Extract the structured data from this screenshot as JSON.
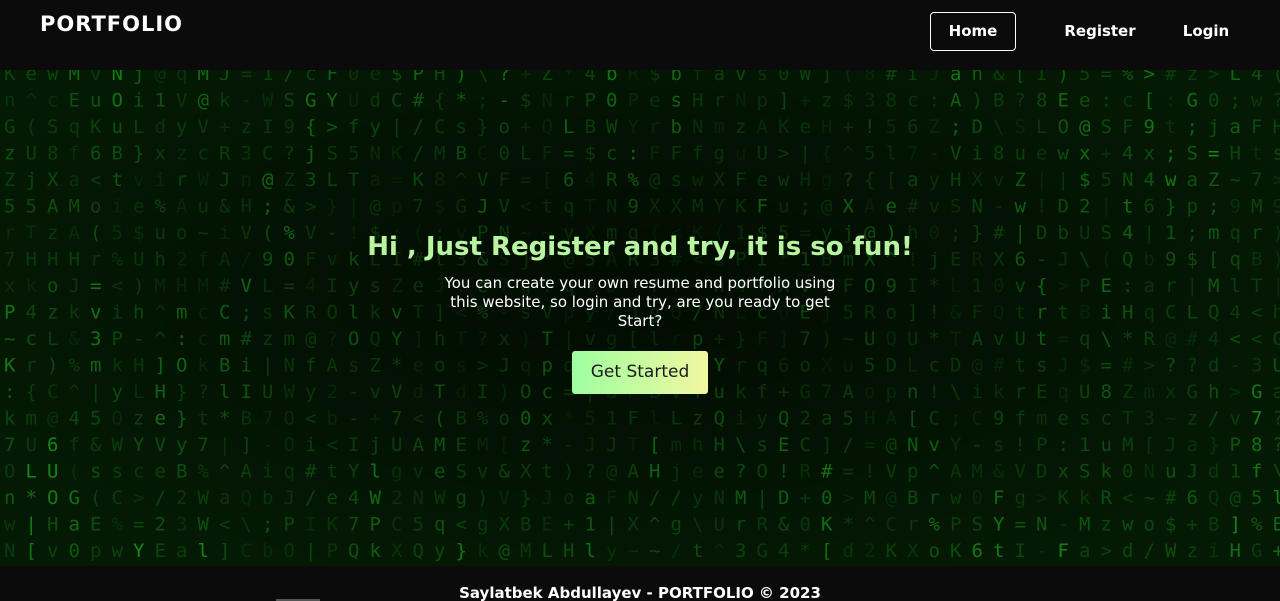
{
  "header": {
    "brand": "PORTFOLIO",
    "nav": [
      {
        "label": "Home",
        "active": true
      },
      {
        "label": "Register"
      },
      {
        "label": "Login"
      }
    ]
  },
  "hero": {
    "title": "Hi , Just Register and try, it is so fun!",
    "text": "You can create your own resume and portfolio using this website, so login and try, are you ready to get Start?",
    "cta": "Get Started",
    "background_icon": "matrix-code-rain"
  },
  "footer": {
    "text": "Saylatbek Abdullayev - PORTFOLIO © 2023"
  },
  "colors": {
    "header_bg": "#0b0b0b",
    "hero_bg": "#041a04",
    "matrix_green": "#22c322",
    "title": "#b9f5a0",
    "cta_start": "#9effa0",
    "cta_end": "#f2f7a1"
  }
}
